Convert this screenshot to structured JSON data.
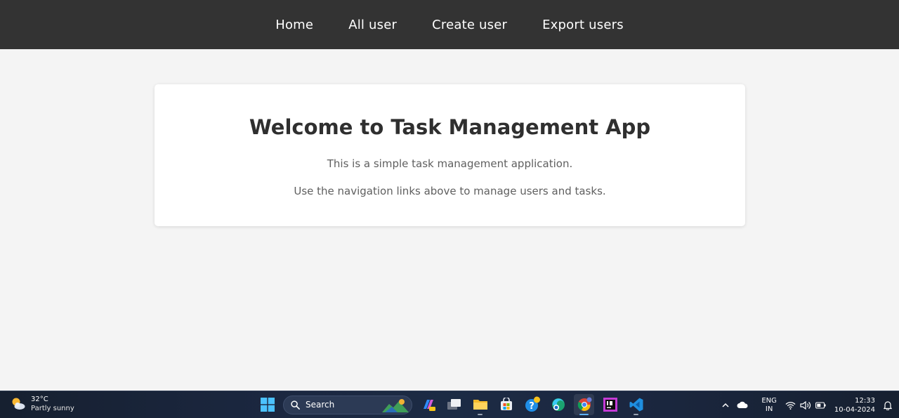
{
  "nav": {
    "links": [
      {
        "label": "Home"
      },
      {
        "label": "All user"
      },
      {
        "label": "Create user"
      },
      {
        "label": "Export users"
      }
    ],
    "background": "#333333"
  },
  "welcome": {
    "title": "Welcome to Task Management App",
    "line1": "This is a simple task management application.",
    "line2": "Use the navigation links above to manage users and tasks."
  },
  "taskbar": {
    "weather": {
      "temp": "32°C",
      "desc": "Partly sunny",
      "icon": "partly-sunny-icon"
    },
    "search_label": "Search",
    "apps": [
      {
        "name": "windows-start",
        "icon": "windows-logo-icon"
      },
      {
        "name": "copilot",
        "icon": "copilot-icon"
      },
      {
        "name": "task-view",
        "icon": "task-view-icon"
      },
      {
        "name": "file-explorer",
        "icon": "folder-icon"
      },
      {
        "name": "microsoft-store",
        "icon": "store-icon"
      },
      {
        "name": "get-help",
        "icon": "help-icon"
      },
      {
        "name": "microsoft-edge",
        "icon": "edge-icon"
      },
      {
        "name": "google-chrome",
        "icon": "chrome-icon"
      },
      {
        "name": "intellij-idea",
        "icon": "intellij-icon"
      },
      {
        "name": "visual-studio-code",
        "icon": "vscode-icon"
      }
    ],
    "tray": {
      "lang_top": "ENG",
      "lang_bottom": "IN",
      "time": "12:33",
      "date": "10-04-2024"
    }
  }
}
